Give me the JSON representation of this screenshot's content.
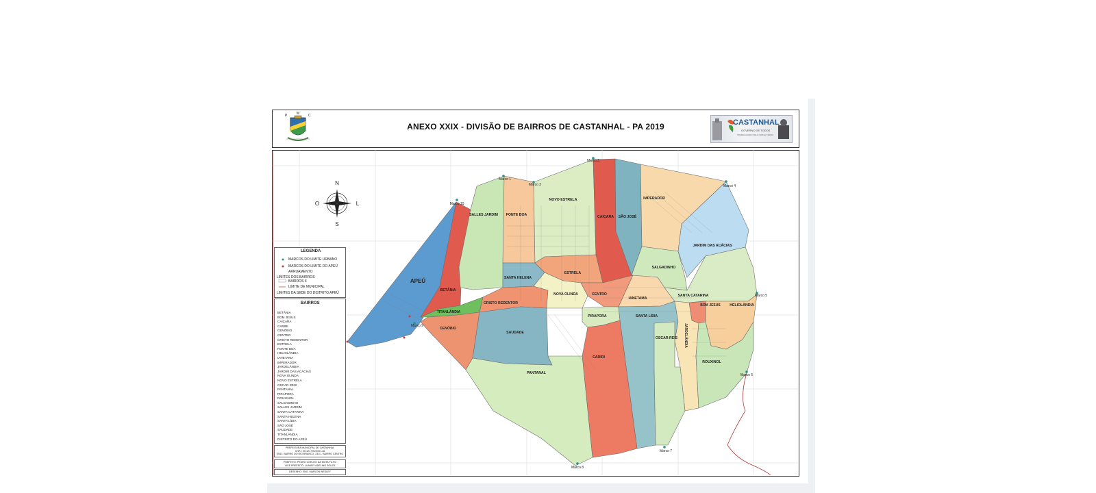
{
  "title": "ANEXO XXIX - DIVISÃO DE BAIRROS DE CASTANHAL - PA   2019",
  "crest_letters": [
    "P",
    "M",
    "C"
  ],
  "logo": {
    "name": "CASTANHAL",
    "subtitle": "GOVERNO DE TODOS",
    "tagline": "TRABALHANDO PELA NOSSA TERRA"
  },
  "compass": {
    "n": "N",
    "s": "S",
    "e": "L",
    "w": "O"
  },
  "legend": {
    "title": "LEGENDA",
    "items": [
      "MARCOS DO LIMITE URBANO",
      "MARCOS DO LIMITE DO APEÚ",
      "ARRUAMENTO",
      "LIMITES DOS BAIRROS",
      "BAIRROS II",
      "LIMITE DE MUNICIPAL",
      "LIMITES DA SEDE DO DISTRITO APEÚ"
    ]
  },
  "bairros_legend": {
    "title": "BAIRROS",
    "items": [
      "BETÂNIA",
      "BOM JESUS",
      "CAIÇARA",
      "CARIRI",
      "CENÓBIO",
      "CENTRO",
      "CRISTO REDENTOR",
      "ESTRELA",
      "FONTE BOA",
      "HELIOLÂNDIA",
      "IANETAMA",
      "IMPERADOR",
      "JARDELÂNDIA",
      "JARDIM DAS ACÁCIAS",
      "NOVA OLINDA",
      "NOVO ESTRELA",
      "OSCAR REIS",
      "PANTANAL",
      "PIRAPORA",
      "ROUXINOL",
      "SALGADINHO",
      "SALLES JARDIM",
      "SANTA CATARINA",
      "SANTA HELENA",
      "SANTA LÍDIA",
      "SÃO JOSÉ",
      "SAUDADE",
      "TITANLÂNDIA",
      "DISTRITO DO APEÚ"
    ]
  },
  "footer": {
    "box1": [
      "PREFEITURA MUNICIPAL DE CASTANHAL",
      "CNPJ: 05.121.991/0001-46",
      "END.: BAIRRO DO RIO BRANCO, 2311 - BAIRRO CENTRO"
    ],
    "box2": [
      "PREFEITO: PEDRO COELHO DA MOTA FILHO",
      "VICE PREFEITO: LUANDY ADELINO SOUZA"
    ],
    "box3": [
      "DESENHO: ENG. MARLON WESLEY"
    ]
  },
  "neighborhoods": [
    {
      "name": "APEÚ",
      "color": "#5b9bd0"
    },
    {
      "name": "BETÂNIA",
      "color": "#e05a4e"
    },
    {
      "name": "SALLES JARDIM",
      "color": "#c9e7b5"
    },
    {
      "name": "FONTE BOA",
      "color": "#f7c89b"
    },
    {
      "name": "NOVO ESTRELA",
      "color": "#dcedc4"
    },
    {
      "name": "CAIÇARA",
      "color": "#e05a4e"
    },
    {
      "name": "SÃO JOSÉ",
      "color": "#7fb3bf"
    },
    {
      "name": "IMPERADOR",
      "color": "#f8d9ab"
    },
    {
      "name": "JARDIM DAS ACÁCIAS",
      "color": "#bcdcf2"
    },
    {
      "name": "SALGADINHO",
      "color": "#cfe8bc"
    },
    {
      "name": "SANTA HELENA",
      "color": "#8cb9c7"
    },
    {
      "name": "ESTRELA",
      "color": "#f2a57a"
    },
    {
      "name": "TITANLÂNDIA",
      "color": "#6fbf5e"
    },
    {
      "name": "CRISTO REDENTOR",
      "color": "#ef9370"
    },
    {
      "name": "NOVA OLINDA",
      "color": "#f3f2c6"
    },
    {
      "name": "CENTRO",
      "color": "#f29b7c"
    },
    {
      "name": "IANETAMA",
      "color": "#f9d8ad"
    },
    {
      "name": "SANTA CATARINA",
      "color": "#d9ecc6"
    },
    {
      "name": "BOM JESUS",
      "color": "#ef8c74"
    },
    {
      "name": "HELIOLÂNDIA",
      "color": "#f7cf9c"
    },
    {
      "name": "CENÓBIO",
      "color": "#ee9370"
    },
    {
      "name": "SAUDADE",
      "color": "#86b6c4"
    },
    {
      "name": "PIRAPORA",
      "color": "#d8ebc0"
    },
    {
      "name": "SANTA LÍDIA",
      "color": "#96c3c9"
    },
    {
      "name": "JARDELÂNDIA",
      "color": "#f9e4b6"
    },
    {
      "name": "OSCAR REIS",
      "color": "#d3e9c0"
    },
    {
      "name": "ROUXINOL",
      "color": "#c8e6b7"
    },
    {
      "name": "CARIRI",
      "color": "#ed7a62"
    },
    {
      "name": "PANTANAL",
      "color": "#d5ecbf"
    }
  ],
  "marcos": [
    "Marco 1",
    "Marco 2",
    "Marco 3",
    "Marco 4",
    "Marco 5",
    "Marco 6",
    "Marco 7",
    "Marco 8",
    "Marco 9",
    "Marco 10"
  ]
}
